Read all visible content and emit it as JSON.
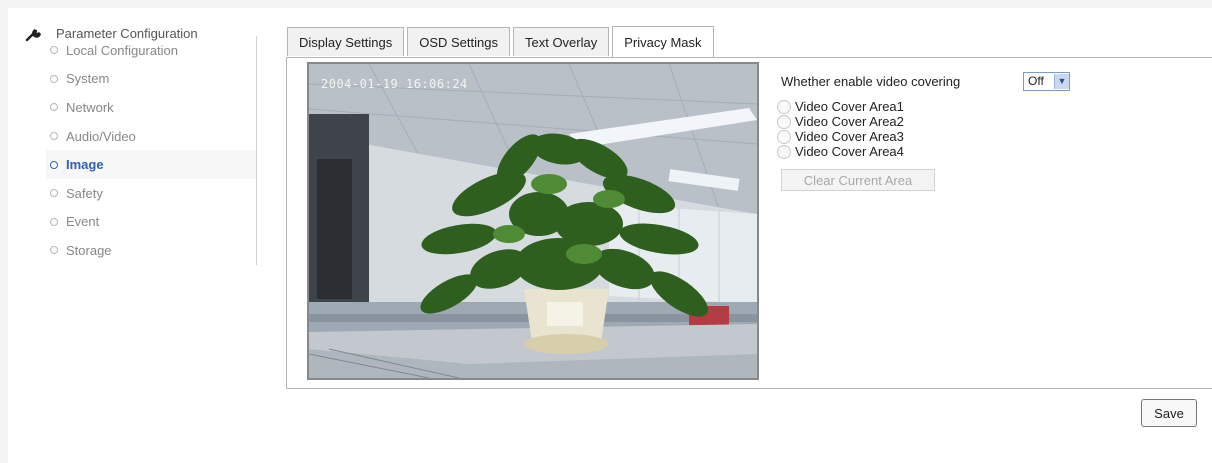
{
  "sidebar": {
    "header": "Parameter Configuration",
    "items": [
      {
        "label": "Local Configuration"
      },
      {
        "label": "System"
      },
      {
        "label": "Network"
      },
      {
        "label": "Audio/Video"
      },
      {
        "label": "Image"
      },
      {
        "label": "Safety"
      },
      {
        "label": "Event"
      },
      {
        "label": "Storage"
      }
    ]
  },
  "tabs": [
    {
      "label": "Display Settings"
    },
    {
      "label": "OSD Settings"
    },
    {
      "label": "Text Overlay"
    },
    {
      "label": "Privacy Mask"
    }
  ],
  "video": {
    "timestamp": "2004-01-19 16:06:24"
  },
  "privacy": {
    "enable_label": "Whether enable video covering",
    "enable_value": "Off",
    "areas": [
      {
        "label": "Video Cover Area1"
      },
      {
        "label": "Video Cover Area2"
      },
      {
        "label": "Video Cover Area3"
      },
      {
        "label": "Video Cover Area4"
      }
    ],
    "clear_button": "Clear Current Area"
  },
  "save_button": "Save",
  "colors": {
    "active_nav": "#2f5fb8",
    "select_border": "#7a9cc9"
  }
}
